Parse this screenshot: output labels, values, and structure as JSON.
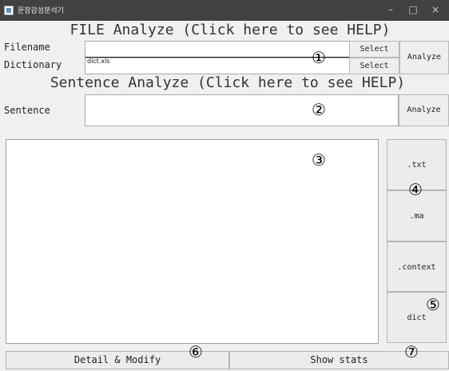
{
  "window": {
    "title": "문장감성분석기",
    "minimize": "–",
    "maximize": "□",
    "close": "×"
  },
  "file_section": {
    "header": "FILE Analyze (Click here to see HELP)",
    "filename_label": "Filename",
    "filename_value": "",
    "dictionary_label": "Dictionary",
    "dictionary_value": "dict.xls",
    "select_label": "Select",
    "analyze_label": "Analyze"
  },
  "sentence_section": {
    "header": "Sentence Analyze (Click here to see HELP)",
    "sentence_label": "Sentence",
    "sentence_value": "",
    "analyze_label": "Analyze"
  },
  "output": {
    "text": ""
  },
  "side_buttons": {
    "txt": ".txt",
    "ma": ".ma",
    "context": ".context",
    "dict": "dict"
  },
  "bottom_buttons": {
    "detail": "Detail & Modify",
    "stats": "Show stats"
  },
  "annotations": [
    "①",
    "②",
    "③",
    "④",
    "⑤",
    "⑥",
    "⑦"
  ]
}
